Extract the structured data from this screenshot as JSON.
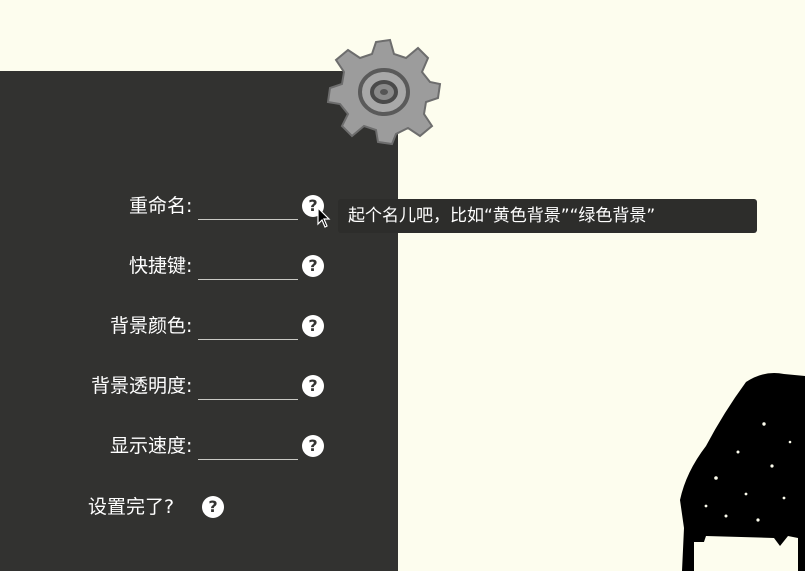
{
  "settings": {
    "rows": [
      {
        "label": "重命名",
        "colon": ":",
        "value": ""
      },
      {
        "label": "快捷键",
        "colon": ":",
        "value": ""
      },
      {
        "label": "背景颜色",
        "colon": ":",
        "value": ""
      },
      {
        "label": "背景透明度",
        "colon": ":",
        "value": ""
      },
      {
        "label": "显示速度",
        "colon": ":",
        "value": ""
      }
    ],
    "done_label": "设置完了?",
    "help_glyph": "?"
  },
  "tooltip": {
    "text": "起个名儿吧，比如“黄色背景”“绿色背景”"
  },
  "icons": {
    "gear": "gear-icon",
    "help": "help-icon",
    "cursor": "mouse-pointer-icon",
    "decoration": "black-ink-blob"
  },
  "colors": {
    "background": "#fdfdee",
    "panel": "#323230",
    "tooltip": "#2d2d2b",
    "text": "#ffffff",
    "gear": "#9c9c9c"
  }
}
